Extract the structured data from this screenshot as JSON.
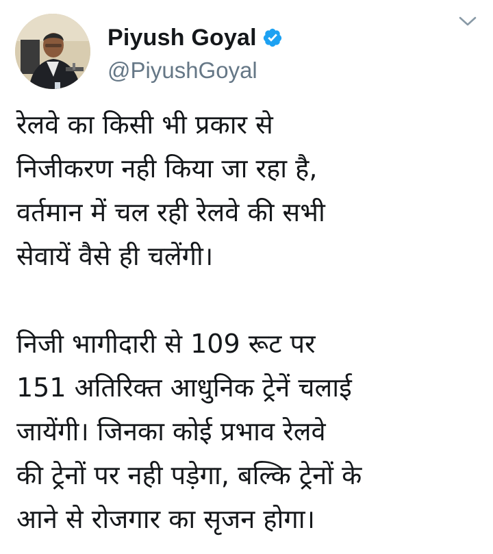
{
  "tweet": {
    "author": {
      "display_name": "Piyush Goyal",
      "handle": "@PiyushGoyal",
      "verified": true,
      "verified_icon": "verified-badge-icon",
      "verified_color": "#1da1f2"
    },
    "menu_icon": "chevron-down-icon",
    "paragraphs": [
      "रेलवे का किसी भी प्रकार से\nनिजीकरण नही किया जा रहा है,\nवर्तमान में चल रही रेलवे की सभी\nसेवायें वैसे ही चलेंगी।",
      "निजी भागीदारी से 109 रूट पर\n151 अतिरिक्त आधुनिक ट्रेनें चलाई\nजायेंगी। जिनका कोई प्रभाव रेलवे\nकी ट्रेनों पर नही पड़ेगा, बल्कि ट्रेनों के\nआने से रोजगार का सृजन होगा।"
    ]
  }
}
